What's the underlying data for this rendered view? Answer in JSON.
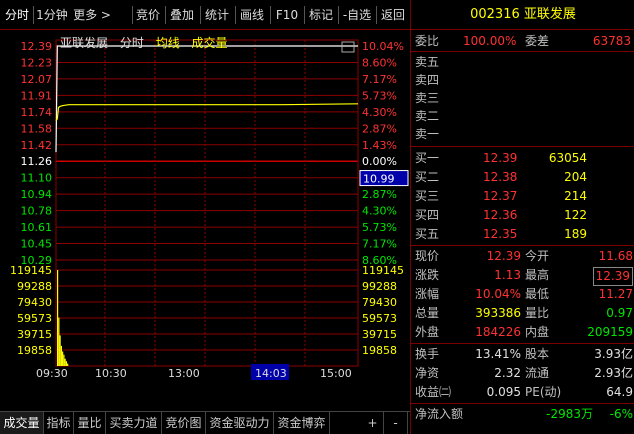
{
  "toolbar": {
    "items": [
      "分时",
      "1分钟",
      "更多 >",
      "竞价",
      "叠加",
      "统计",
      "画线",
      "F10",
      "标记",
      "-自选",
      "返回"
    ]
  },
  "legend": {
    "stock_name": "亚联发展",
    "time_label": "分时",
    "avg_label": "均线",
    "vol_label": "成交量"
  },
  "chart_data": {
    "type": "line",
    "series": [
      {
        "name": "分时",
        "color": "#ffffff",
        "x": [
          "09:30",
          "09:31",
          "09:32",
          "09:33",
          "09:35",
          "09:40",
          "10:00",
          "10:30",
          "11:00",
          "11:30",
          "13:00",
          "14:00",
          "15:00"
        ],
        "values": [
          11.27,
          12.39,
          12.39,
          12.39,
          12.39,
          12.39,
          12.39,
          12.39,
          12.39,
          12.39,
          12.39,
          12.39,
          12.39
        ]
      },
      {
        "name": "均线",
        "color": "#ffff00",
        "x": [
          "09:30",
          "09:31",
          "09:32",
          "09:33",
          "09:35",
          "09:40",
          "10:00",
          "10:30",
          "11:00",
          "11:30",
          "13:00",
          "14:00",
          "15:00"
        ],
        "values": [
          11.6,
          11.62,
          11.74,
          11.75,
          11.76,
          11.77,
          11.77,
          11.77,
          11.77,
          11.77,
          11.77,
          11.77,
          11.78
        ]
      }
    ],
    "volume": {
      "name": "成交量",
      "color": "#ffff00",
      "x": [
        "09:30",
        "09:31",
        "09:32",
        "09:33",
        "09:34",
        "09:35",
        "09:36",
        "09:37",
        "09:38"
      ],
      "values": [
        119145,
        60000,
        38000,
        25000,
        18000,
        14000,
        9000,
        6000,
        3000
      ]
    },
    "price_ticks": [
      "12.39",
      "12.23",
      "12.07",
      "11.91",
      "11.74",
      "11.58",
      "11.42",
      "11.26",
      "11.10",
      "10.94",
      "10.78",
      "10.61",
      "10.45",
      "10.29"
    ],
    "pct_ticks": [
      "10.04%",
      "8.60%",
      "7.17%",
      "5.73%",
      "4.30%",
      "2.87%",
      "1.43%",
      "0.00%",
      "1.43%",
      "2.87%",
      "4.30%",
      "5.73%",
      "7.17%",
      "8.60%"
    ],
    "vol_ticks": [
      "119145",
      "99288",
      "79430",
      "59573",
      "39715",
      "19858"
    ],
    "x_ticks": [
      "09:30",
      "10:30",
      "13:00",
      "14:03",
      "15:00"
    ],
    "ylim": [
      10.13,
      12.39
    ],
    "prev_close": 11.26,
    "cursor_price": "10.99",
    "cursor_time": "14:03",
    "colors": {
      "up": "#ff3232",
      "down": "#00e600",
      "flat": "#ffffff",
      "grid": "#8b0000",
      "cursor_bg": "#0000aa"
    }
  },
  "bottom_tabs": [
    "成交量",
    "指标",
    "量比",
    "买卖力道",
    "竞价图",
    "资金驱动力",
    "资金博弈",
    "+",
    "-"
  ],
  "quote": {
    "code_name": "002316 亚联发展",
    "weibi_label": "委比",
    "weibi_value": "100.00%",
    "weicha_label": "委差",
    "weicha_value": "63783",
    "sell": [
      {
        "label": "卖五",
        "price": "",
        "vol": ""
      },
      {
        "label": "卖四",
        "price": "",
        "vol": ""
      },
      {
        "label": "卖三",
        "price": "",
        "vol": ""
      },
      {
        "label": "卖二",
        "price": "",
        "vol": ""
      },
      {
        "label": "卖一",
        "price": "",
        "vol": ""
      }
    ],
    "buy": [
      {
        "label": "买一",
        "price": "12.39",
        "vol": "63054"
      },
      {
        "label": "买二",
        "price": "12.38",
        "vol": "204"
      },
      {
        "label": "买三",
        "price": "12.37",
        "vol": "214"
      },
      {
        "label": "买四",
        "price": "12.36",
        "vol": "122"
      },
      {
        "label": "买五",
        "price": "12.35",
        "vol": "189"
      }
    ],
    "stats": [
      {
        "l1": "现价",
        "v1": "12.39",
        "c1": "red",
        "l2": "今开",
        "v2": "11.68",
        "c2": "red"
      },
      {
        "l1": "涨跌",
        "v1": "1.13",
        "c1": "red",
        "l2": "最高",
        "v2": "12.39",
        "c2": "red"
      },
      {
        "l1": "涨幅",
        "v1": "10.04%",
        "c1": "red",
        "l2": "最低",
        "v2": "11.27",
        "c2": "red"
      },
      {
        "l1": "总量",
        "v1": "393386",
        "c1": "yellow",
        "l2": "量比",
        "v2": "0.97",
        "c2": "green"
      },
      {
        "l1": "外盘",
        "v1": "184226",
        "c1": "red",
        "l2": "内盘",
        "v2": "209159",
        "c2": "green"
      }
    ],
    "stats2": [
      {
        "l1": "换手",
        "v1": "13.41%",
        "l2": "股本",
        "v2": "3.93亿"
      },
      {
        "l1": "净资",
        "v1": "2.32",
        "l2": "流通",
        "v2": "2.93亿"
      },
      {
        "l1": "收益㈡",
        "v1": "0.095",
        "l2": "PE(动)",
        "v2": "64.9"
      }
    ],
    "flow": {
      "label": "净流入额",
      "value": "-2983万",
      "pct": "-6%"
    }
  }
}
